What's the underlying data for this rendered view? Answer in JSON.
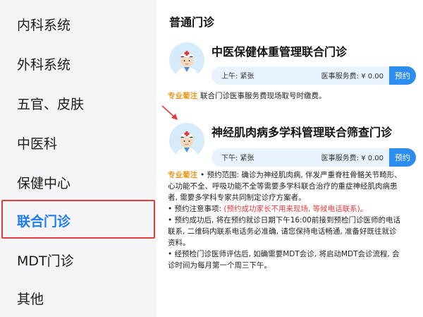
{
  "sidebar": {
    "items": [
      {
        "label": "内科系统"
      },
      {
        "label": "外科系统"
      },
      {
        "label": "五官、皮肤"
      },
      {
        "label": "中医科"
      },
      {
        "label": "保健中心"
      },
      {
        "label": "联合门诊"
      },
      {
        "label": "MDT门诊"
      },
      {
        "label": "其他"
      }
    ],
    "active_index": 5
  },
  "main": {
    "section_title": "普通门诊",
    "clinics": [
      {
        "title": "中医保健体重管理联合门诊",
        "slot_status": "上午: 紧张",
        "fee": "医事服务费: ¥ 0.00",
        "button": "预约"
      },
      {
        "title": "神经肌肉病多学科管理联合筛查门诊",
        "slot_status": "下午: 紧张",
        "fee": "医事服务费: ¥ 0.00",
        "button": "预约"
      }
    ],
    "note1": {
      "tag": "专业葡注",
      "text": "联合门诊医事服务费现场取号时缴费。"
    },
    "note2": {
      "tag": "专业葡注",
      "line1": "• 预约范围: 确诊为神经肌肉病, 伴发严重脊柱骨骼关节畸形、",
      "line2": "心功能不全、呼吸功能不全等需要多学科联合治疗的重症神经肌肉病患",
      "line3": "者, 需要多学科专家共同制定诊疗方案者。",
      "line4_prefix": "• 预约注意事项: ",
      "line4_red": "(预约成功家长不用来现场, 等候电话联系)。",
      "line5": "• 预约成功后, 将在预约就诊日期下午16:00前接到预检门诊医师的电话",
      "line6": "联系, 二维码内联系电话务必准确, 请您保持电话畅通, 准备好既往就诊",
      "line7": "资料。",
      "line8": "• 经预检门诊医师评估后, 如确需要MDT会诊, 将启动MDT会诊流程, 会",
      "line9": "诊时间为每月第一个周三下午。"
    }
  },
  "colors": {
    "accent": "#2d8cf0",
    "highlight_frame": "#e23b3b",
    "tag": "#e69a1e"
  }
}
